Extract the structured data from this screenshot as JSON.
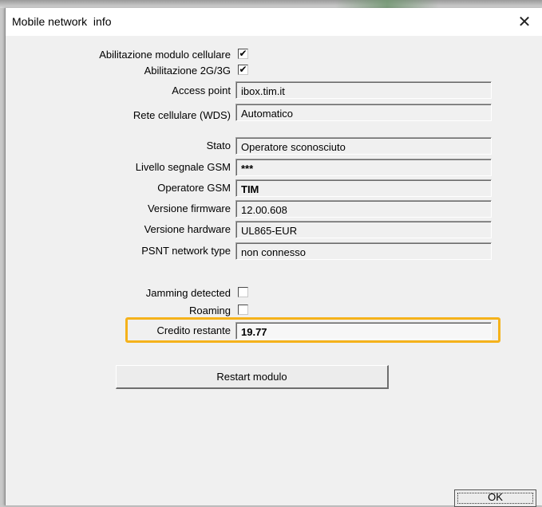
{
  "window": {
    "title": "Mobile network  info",
    "close_glyph": "✕"
  },
  "checks_top": [
    {
      "label": "Abilitazione modulo cellulare",
      "checked": true,
      "mark": "✔"
    },
    {
      "label": "Abilitazione 2G/3G",
      "checked": true,
      "mark": "✔"
    }
  ],
  "config_fields": [
    {
      "label": "Access point",
      "value": "ibox.tim.it"
    },
    {
      "label": "Rete cellulare (WDS)",
      "value": "Automatico"
    }
  ],
  "status_fields": [
    {
      "label": "Stato",
      "value": "Operatore sconosciuto"
    },
    {
      "label": "Livello segnale GSM",
      "value": "***"
    },
    {
      "label": "Operatore GSM",
      "value": "TIM"
    },
    {
      "label": "Versione firmware",
      "value": "12.00.608"
    },
    {
      "label": "Versione hardware",
      "value": "UL865-EUR"
    },
    {
      "label": "PSNT network type",
      "value": "non connesso"
    }
  ],
  "checks_bottom": [
    {
      "label": "Jamming detected",
      "checked": false,
      "mark": ""
    },
    {
      "label": "Roaming",
      "checked": false,
      "mark": ""
    }
  ],
  "credit": {
    "label": "Credito restante",
    "value": "19.77"
  },
  "buttons": {
    "restart": "Restart modulo",
    "ok": "OK"
  },
  "colors": {
    "highlight": "#f5b21b",
    "dialog_bg": "#f0f0f0"
  }
}
